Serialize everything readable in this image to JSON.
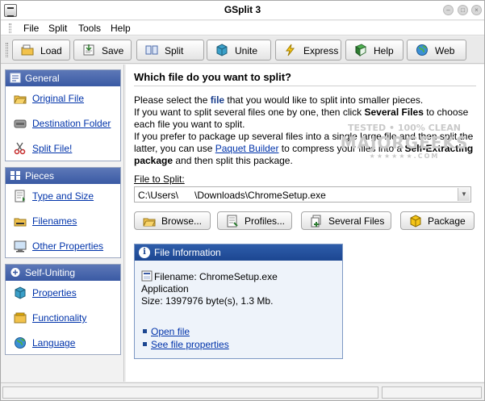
{
  "window": {
    "title": "GSplit 3"
  },
  "menu": [
    "File",
    "Split",
    "Tools",
    "Help"
  ],
  "toolbar": [
    {
      "label": "Load",
      "icon": "load-icon"
    },
    {
      "label": "Save",
      "icon": "save-icon"
    },
    {
      "label": "Split",
      "icon": "split-icon"
    },
    {
      "label": "Unite",
      "icon": "unite-icon"
    },
    {
      "label": "Express",
      "icon": "express-icon"
    },
    {
      "label": "Help",
      "icon": "help-book-icon"
    },
    {
      "label": "Web",
      "icon": "globe-icon"
    }
  ],
  "sidebar": {
    "groups": [
      {
        "title": "General",
        "items": [
          "Original File",
          "Destination Folder",
          "Split File!"
        ]
      },
      {
        "title": "Pieces",
        "items": [
          "Type and Size",
          "Filenames",
          "Other Properties"
        ]
      },
      {
        "title": "Self-Uniting",
        "items": [
          "Properties",
          "Functionality",
          "Language"
        ]
      }
    ]
  },
  "main": {
    "heading": "Which file do you want to split?",
    "p1_a": "Please select the ",
    "p1_b": "file",
    "p1_c": " that you would like to split into smaller pieces.",
    "p2_a": "If you want to split several files one by one, then click ",
    "p2_b": "Several Files",
    "p2_c": " to choose each file you want to split.",
    "p3_a": "If you prefer to package up several files into a single large file and then split the latter, you can use ",
    "p3_link": "Paquet Builder",
    "p3_b": " to compress your files into a ",
    "p3_c": "Self-Extracting package",
    "p3_d": " and then split this package.",
    "file_label": "File to Split:",
    "file_value": "C:\\Users\\      \\Downloads\\ChromeSetup.exe",
    "buttons": [
      "Browse...",
      "Profiles...",
      "Several Files",
      "Package"
    ]
  },
  "file_info": {
    "title": "File Information",
    "filename": "Filename: ChromeSetup.exe",
    "type": "Application",
    "size": "Size: 1397976 byte(s), 1.3 Mb.",
    "link1": "Open file",
    "link2": "See file properties"
  },
  "watermark": {
    "line1": "TESTED • 100% CLEAN",
    "line2": "MAJORGEEKS",
    "line3": "★★★★★★.COM"
  },
  "colors": {
    "panel_header": "#3a5aa4",
    "info_header": "#1c4691",
    "link": "#0033aa"
  }
}
